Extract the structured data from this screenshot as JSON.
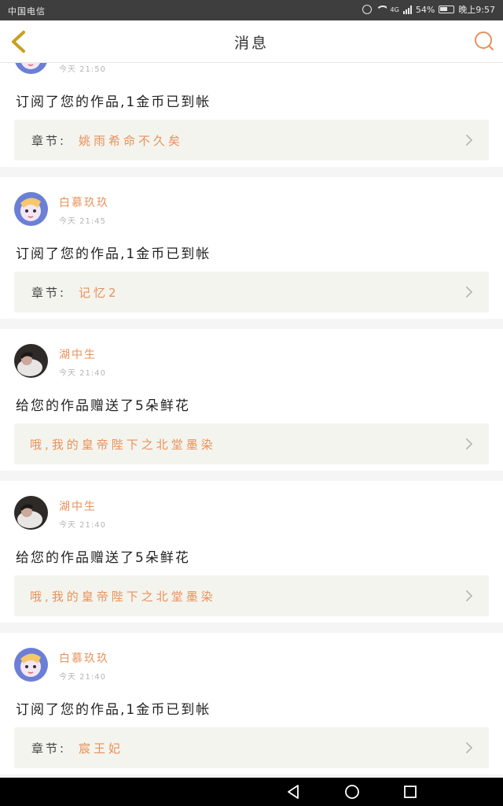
{
  "status_bar": {
    "carrier": "中国电信",
    "network": "4G",
    "battery": "54%",
    "time": "晚上9:57"
  },
  "header": {
    "title": "消息",
    "back_icon": "chevron-left-icon",
    "search_icon": "search-icon"
  },
  "colors": {
    "accent_orange": "#e8915a",
    "back_arrow": "#c8a020",
    "chapter_bg": "#f4f4ee"
  },
  "messages": [
    {
      "user": "",
      "time": "今天 21:50",
      "text": "订阅了您的作品,1金币已到帐",
      "chapter_prefix": "章节:",
      "chapter_title": "姚雨希命不久矣",
      "avatar": "avatar-anime"
    },
    {
      "user": "白慕玖玖",
      "time": "今天 21:45",
      "text": "订阅了您的作品,1金币已到帐",
      "chapter_prefix": "章节:",
      "chapter_title": "记忆2",
      "avatar": "avatar-anime"
    },
    {
      "user": "湖中生",
      "time": "今天 21:40",
      "text": "给您的作品赠送了5朵鲜花",
      "chapter_prefix": "",
      "chapter_title": "哦,我的皇帝陛下之北堂墨染",
      "avatar": "avatar-photo"
    },
    {
      "user": "湖中生",
      "time": "今天 21:40",
      "text": "给您的作品赠送了5朵鲜花",
      "chapter_prefix": "",
      "chapter_title": "哦,我的皇帝陛下之北堂墨染",
      "avatar": "avatar-photo"
    },
    {
      "user": "白慕玖玖",
      "time": "今天 21:40",
      "text": "订阅了您的作品,1金币已到帐",
      "chapter_prefix": "章节:",
      "chapter_title": "宸王妃",
      "avatar": "avatar-anime"
    }
  ],
  "nav_bar": {
    "back_icon": "triangle-back-icon",
    "home_icon": "circle-home-icon",
    "recents_icon": "square-recents-icon"
  }
}
